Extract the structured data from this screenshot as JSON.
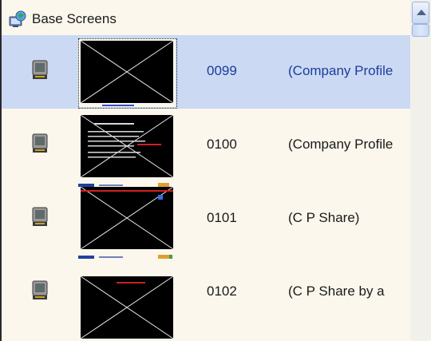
{
  "header": {
    "title": "Base Screens",
    "icon": "base-screens-folder-icon"
  },
  "rows": [
    {
      "id": "0099",
      "name": "(Company Profile",
      "selected": true,
      "icon": "screen-monitor-icon"
    },
    {
      "id": "0100",
      "name": "(Company Profile",
      "selected": false,
      "icon": "screen-monitor-icon"
    },
    {
      "id": "0101",
      "name": "(C P Share)",
      "selected": false,
      "icon": "screen-monitor-icon"
    },
    {
      "id": "0102",
      "name": "(C P Share by a",
      "selected": false,
      "icon": "screen-monitor-icon"
    }
  ],
  "colors": {
    "background": "#fbf7ec",
    "selected_row": "#cbd9f3",
    "selected_text": "#1c3d9c",
    "thumbnail_bg": "#000000"
  }
}
